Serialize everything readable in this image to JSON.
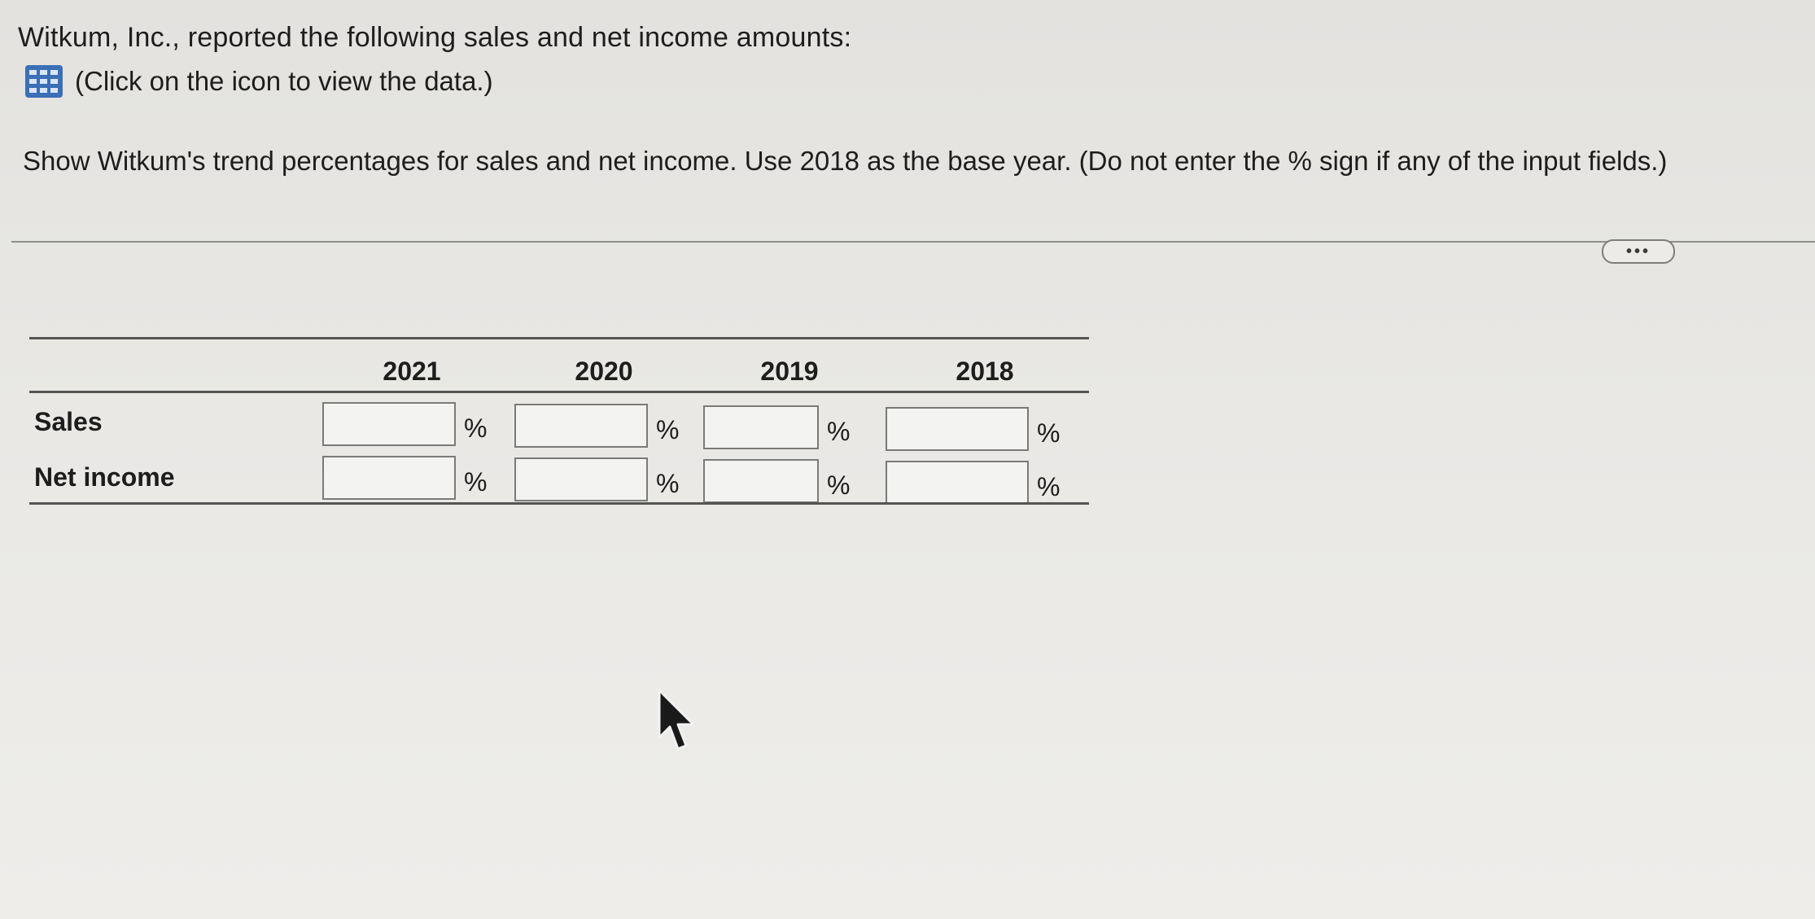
{
  "question": {
    "intro": "Witkum, Inc., reported the following sales and net income amounts:",
    "data_link_label": "(Click on the icon to view the data.)",
    "data_icon": "table-grid-icon",
    "instruction": "Show Witkum's trend percentages for sales and net income. Use 2018 as the base year. (Do not enter the % sign if any of the input fields.)",
    "more_button_label": "•••"
  },
  "table": {
    "columns": [
      "2021",
      "2020",
      "2019",
      "2018"
    ],
    "rows": [
      {
        "label": "Sales",
        "inputs": [
          "",
          "",
          "",
          ""
        ],
        "unit": "%"
      },
      {
        "label": "Net income",
        "inputs": [
          "",
          "",
          "",
          ""
        ],
        "unit": "%"
      }
    ]
  },
  "colors": {
    "background": "#e6e5e2",
    "icon_blue": "#3b6fb6",
    "text": "#1d1d1d"
  }
}
